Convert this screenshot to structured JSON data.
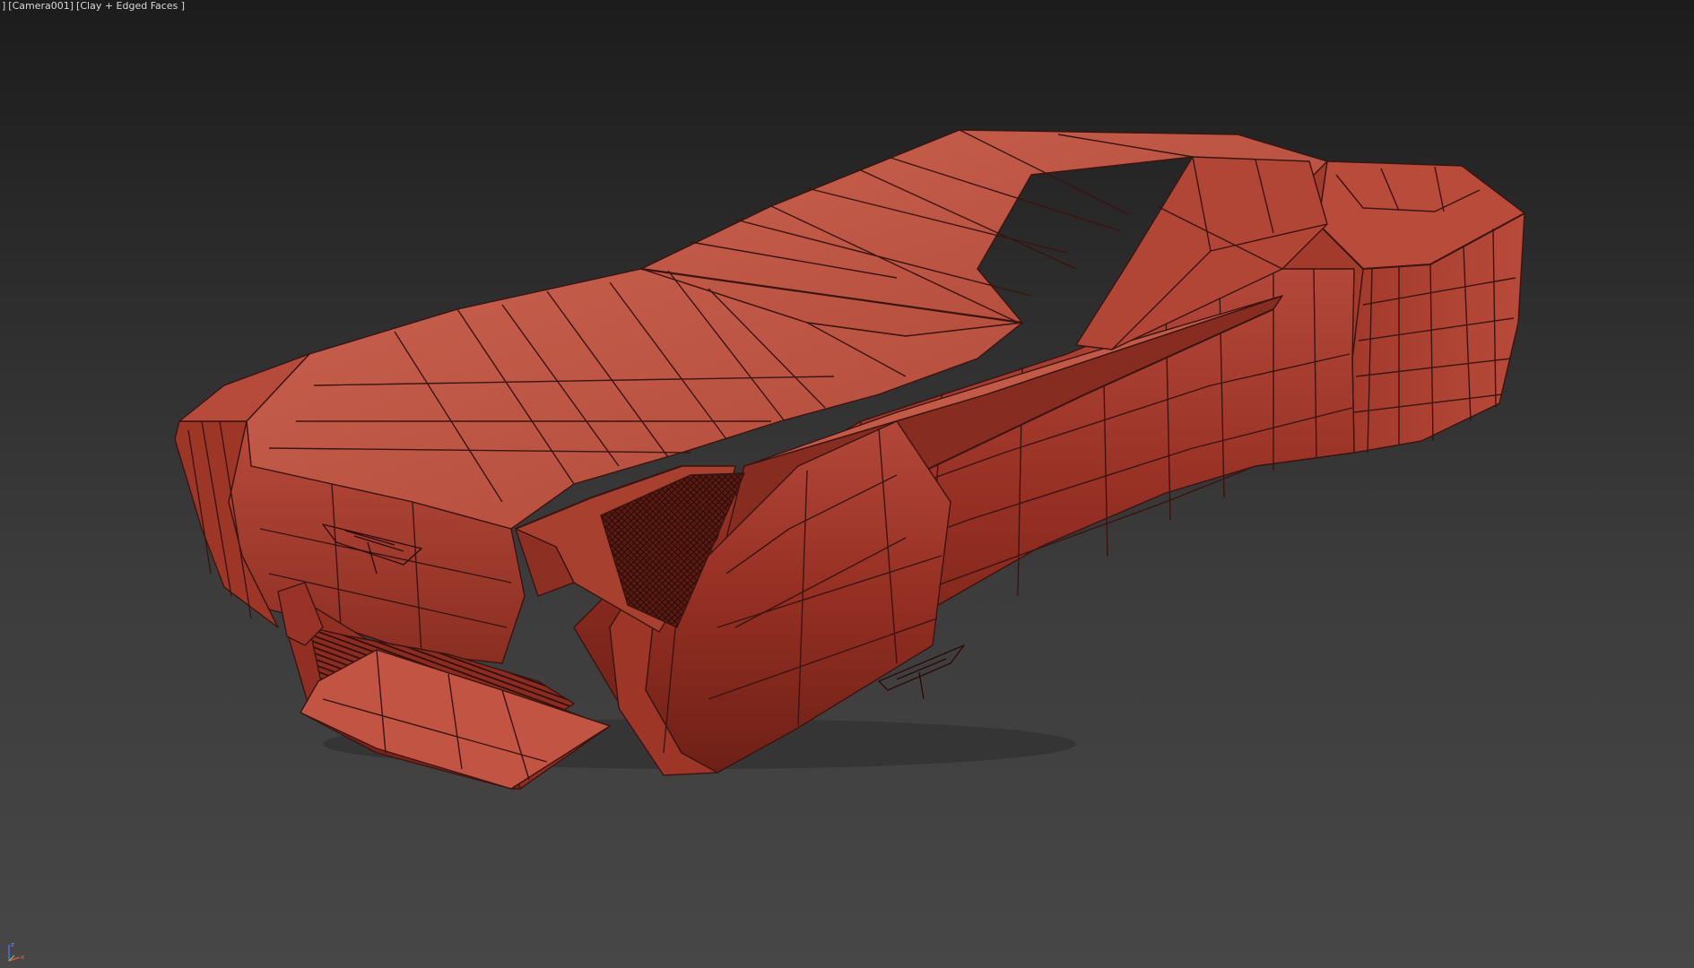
{
  "viewport": {
    "menu_bracket": "]",
    "camera_label": "[Camera001]",
    "shading_label": "[Clay + Edged Faces ]"
  },
  "gizmo": {
    "z_label": "z",
    "x_label": "x"
  },
  "colors": {
    "clay_light": "#c45a4a",
    "clay_mid": "#a8402f",
    "clay_dark": "#7a2418",
    "edge": "#3a1410",
    "background_top": "#1c1c1c",
    "background_bottom": "#474747"
  },
  "model": {
    "name": "hover car clay model"
  }
}
